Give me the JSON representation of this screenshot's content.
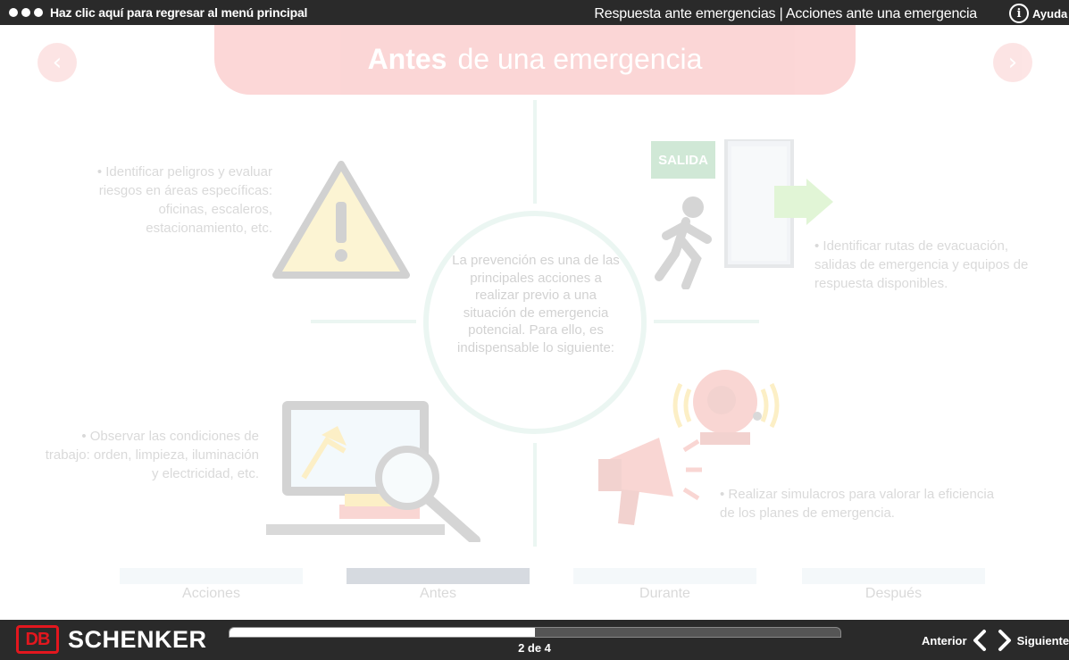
{
  "topbar": {
    "menu_link": "Haz clic aquí para regresar al menú principal",
    "title": "Respuesta ante emergencias | Acciones ante una emergencia",
    "help_label": "Ayuda"
  },
  "banner": {
    "title_bold": "Antes",
    "title_rest": "de una emergencia"
  },
  "center_text": "La prevención es una de las principales acciones a realizar previo a una situación de emergencia potencial. Para ello, es indispensable lo siguiente:",
  "items": {
    "top_left": "• Identificar peligros y evaluar riesgos en áreas específicas: oficinas, escaleros, estacionamiento, etc.",
    "top_right": "• Identificar rutas de evacuación, salidas de emergencia y equipos de respuesta disponibles.",
    "bottom_left": "• Observar las condiciones de trabajo: orden, limpieza, iluminación y electricidad, etc.",
    "bottom_right": "• Realizar simulacros para valorar la eficiencia de los planes de emergencia."
  },
  "exit_sign": "SALIDA",
  "steps": [
    {
      "label": "Acciones"
    },
    {
      "label": "Antes"
    },
    {
      "label": "Durante"
    },
    {
      "label": "Después"
    }
  ],
  "active_step": "Antes",
  "footer": {
    "logo_db": "DB",
    "logo_name": "SCHENKER",
    "page_indicator": "2 de 4",
    "progress_fraction": 0.5,
    "prev_label": "Anterior",
    "next_label": "Siguiente"
  },
  "colors": {
    "accent": "#f04a4a",
    "bar": "#2a2a2a",
    "brand_red": "#e3171e"
  },
  "icons": [
    "warning-icon",
    "exit-sign-icon",
    "running-person-icon",
    "alarm-bell-icon",
    "megaphone-icon",
    "desk-magnifier-icon",
    "info-icon",
    "chevron-left-icon",
    "chevron-right-icon"
  ]
}
